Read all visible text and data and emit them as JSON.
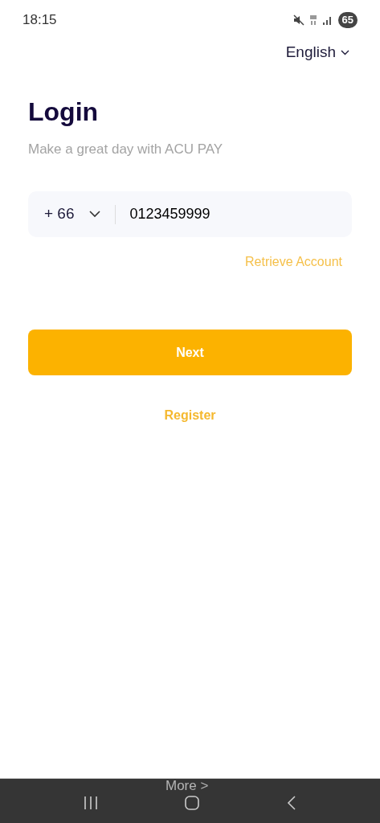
{
  "status_bar": {
    "time": "18:15",
    "battery": "65"
  },
  "language": {
    "label": "English"
  },
  "title": "Login",
  "subtitle": "Make a great day with ACU PAY",
  "phone_field": {
    "country_code": "+ 66",
    "value": "0123459999"
  },
  "retrieve_link": "Retrieve Account",
  "next_button": "Next",
  "register_link": "Register",
  "more_link": "More >"
}
